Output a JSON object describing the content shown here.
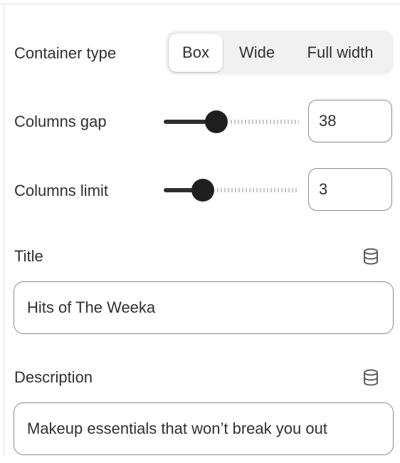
{
  "container_type": {
    "label": "Container type",
    "options": [
      "Box",
      "Wide",
      "Full width"
    ],
    "selected": "Box"
  },
  "columns_gap": {
    "label": "Columns gap",
    "value": "38",
    "slider_fraction": 0.39
  },
  "columns_limit": {
    "label": "Columns limit",
    "value": "3",
    "slider_fraction": 0.29
  },
  "title": {
    "label": "Title",
    "value": "Hits of The Weeka",
    "icon": "database-icon"
  },
  "description": {
    "label": "Description",
    "value": "Makeup essentials that won’t break you out",
    "icon": "database-icon"
  }
}
